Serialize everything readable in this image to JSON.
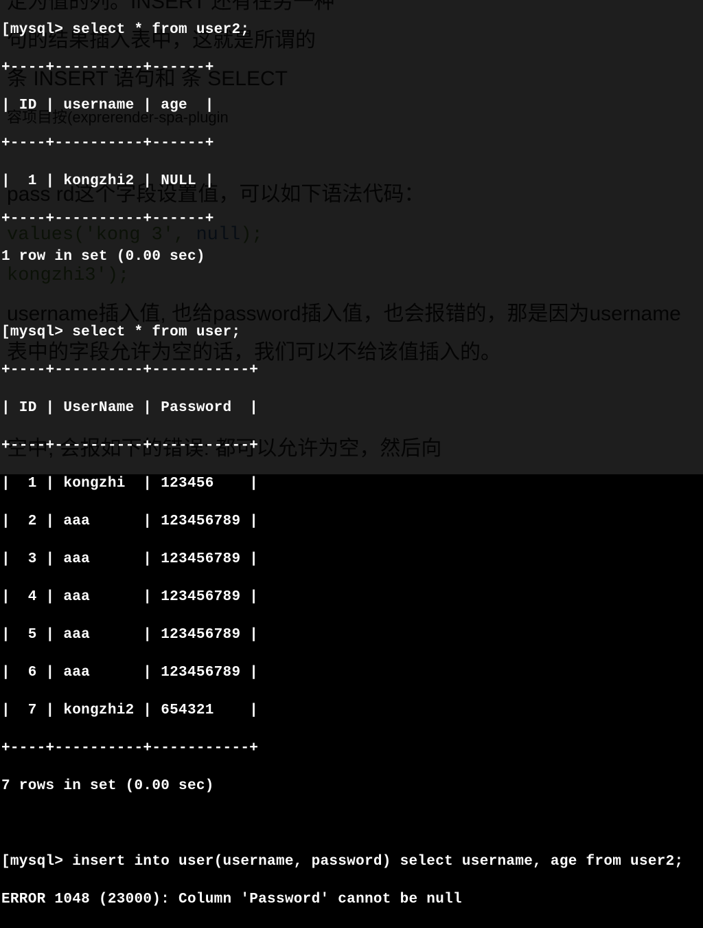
{
  "bg": {
    "l1": "定为值的列。INSERT 还有在另一种",
    "l2": "句的结果插入表中，这就是所谓的",
    "l3": "   条  INSERT 语句和   条 SELECT",
    "l4_a": "容项目按(exprerender-spa-plugin",
    "l5": "pass  rd这个字段设置值，可以如下语法代码：",
    "l6_a": "values('kong  3', ",
    "l6_b": "null",
    "l6_c": ");",
    "l7": "kongzhi3');",
    "l8": "username插入值, 也给password插入值，也会报错的，那是因为username",
    "l9": "表中的字段允许为空的话，我们可以不给该值插入的。",
    "l10": "空中,           会报如下的错误:  都可以允许为空，然后向"
  },
  "term": {
    "prompt": "mysql>",
    "q1": "[mysql> select * from user2;",
    "sep1a": "+----+----------+------+",
    "hdr1": "| ID | username | age  |",
    "sep1b": "+----+----------+------+",
    "row1a": "|  1 | kongzhi2 | NULL |",
    "sep1c": "+----+----------+------+",
    "res1": "1 row in set (0.00 sec)",
    "q2": "[mysql> select * from user;",
    "sep2a": "+----+----------+-----------+",
    "hdr2": "| ID | UserName | Password  |",
    "sep2b": "+----+----------+-----------+",
    "r2_1": "|  1 | kongzhi  | 123456    |",
    "r2_2": "|  2 | aaa      | 123456789 |",
    "r2_3": "|  3 | aaa      | 123456789 |",
    "r2_4": "|  4 | aaa      | 123456789 |",
    "r2_5": "|  5 | aaa      | 123456789 |",
    "r2_6": "|  6 | aaa      | 123456789 |",
    "r2_7": "|  7 | kongzhi2 | 654321    |",
    "sep2c": "+----+----------+-----------+",
    "res2": "7 rows in set (0.00 sec)",
    "q3": "[mysql> insert into user(username, password) select username, age from user2;",
    "err": "ERROR 1048 (23000): Column 'Password' cannot be null"
  }
}
